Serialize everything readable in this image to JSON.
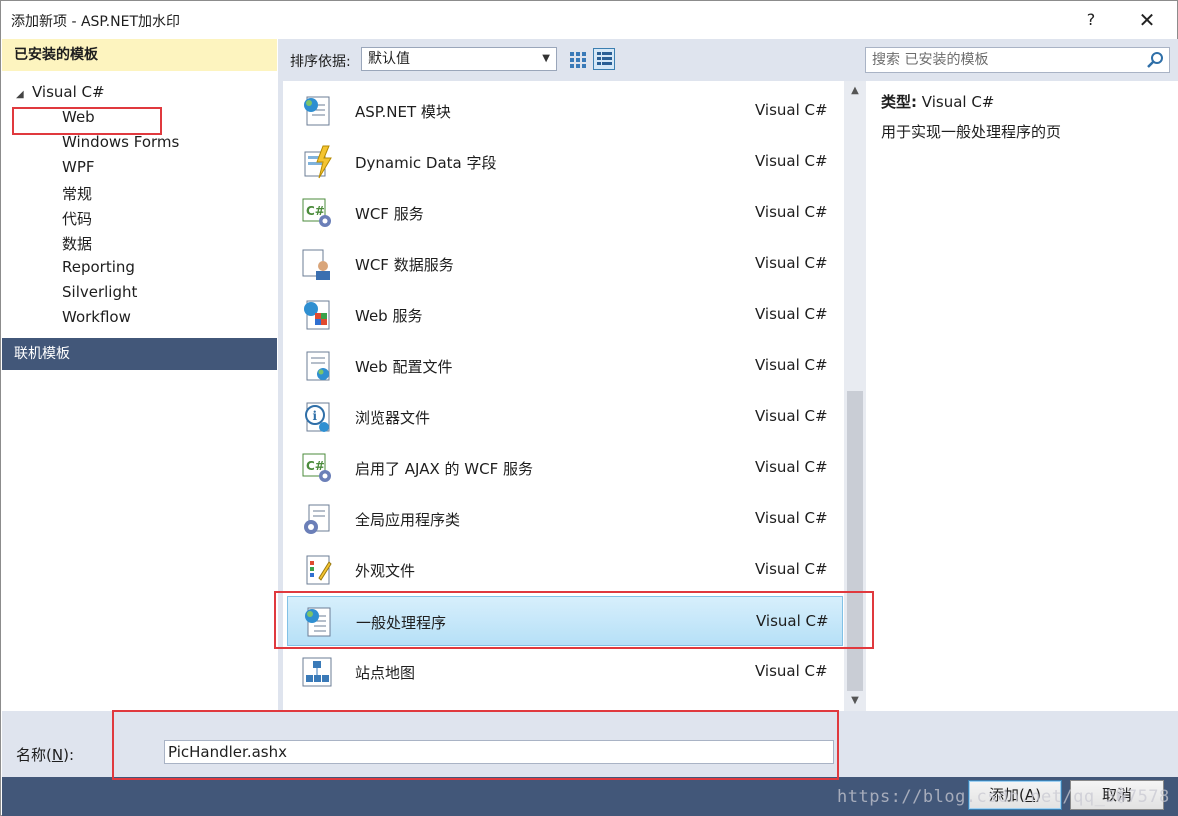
{
  "window": {
    "title": "添加新项 - ASP.NET加水印",
    "help_label": "?",
    "close_label": "✕"
  },
  "left_panel": {
    "installed_header": "已安装的模板",
    "tree_root": "Visual C#",
    "tree_items": [
      "Web",
      "Windows Forms",
      "WPF",
      "常规",
      "代码",
      "数据",
      "Reporting",
      "Silverlight",
      "Workflow"
    ],
    "online_header": "联机模板"
  },
  "toolbar": {
    "sort_label": "排序依据:",
    "sort_value": "默认值",
    "search_placeholder": "搜索 已安装的模板"
  },
  "templates": [
    {
      "name": "ASP.NET 模块",
      "lang": "Visual C#",
      "icon": "aspnet-module-icon"
    },
    {
      "name": "Dynamic Data 字段",
      "lang": "Visual C#",
      "icon": "dynamic-data-icon"
    },
    {
      "name": "WCF 服务",
      "lang": "Visual C#",
      "icon": "wcf-service-icon"
    },
    {
      "name": "WCF 数据服务",
      "lang": "Visual C#",
      "icon": "wcf-data-service-icon"
    },
    {
      "name": "Web 服务",
      "lang": "Visual C#",
      "icon": "web-service-icon"
    },
    {
      "name": "Web 配置文件",
      "lang": "Visual C#",
      "icon": "web-config-icon"
    },
    {
      "name": "浏览器文件",
      "lang": "Visual C#",
      "icon": "browser-file-icon"
    },
    {
      "name": "启用了 AJAX 的 WCF 服务",
      "lang": "Visual C#",
      "icon": "ajax-wcf-icon"
    },
    {
      "name": "全局应用程序类",
      "lang": "Visual C#",
      "icon": "global-app-icon"
    },
    {
      "name": "外观文件",
      "lang": "Visual C#",
      "icon": "skin-file-icon"
    },
    {
      "name": "一般处理程序",
      "lang": "Visual C#",
      "icon": "generic-handler-icon",
      "selected": true
    },
    {
      "name": "站点地图",
      "lang": "Visual C#",
      "icon": "sitemap-icon"
    }
  ],
  "details": {
    "type_label": "类型:",
    "type_value": "Visual C#",
    "description": "用于实现一般处理程序的页"
  },
  "name_field": {
    "label_prefix": "名称(",
    "label_key": "N",
    "label_suffix": "):",
    "value": "PicHandler.ashx"
  },
  "buttons": {
    "add_prefix": "添加(",
    "add_key": "A",
    "add_suffix": ")",
    "cancel": "取消"
  },
  "watermark": "https://blog.csdn.net/qq_3�7578",
  "colors": {
    "installed_header_bg": "#fdf4bf",
    "online_header_bg": "#425779",
    "annotation_red": "#e0393e",
    "selection_blue": "#b6e0f7"
  }
}
